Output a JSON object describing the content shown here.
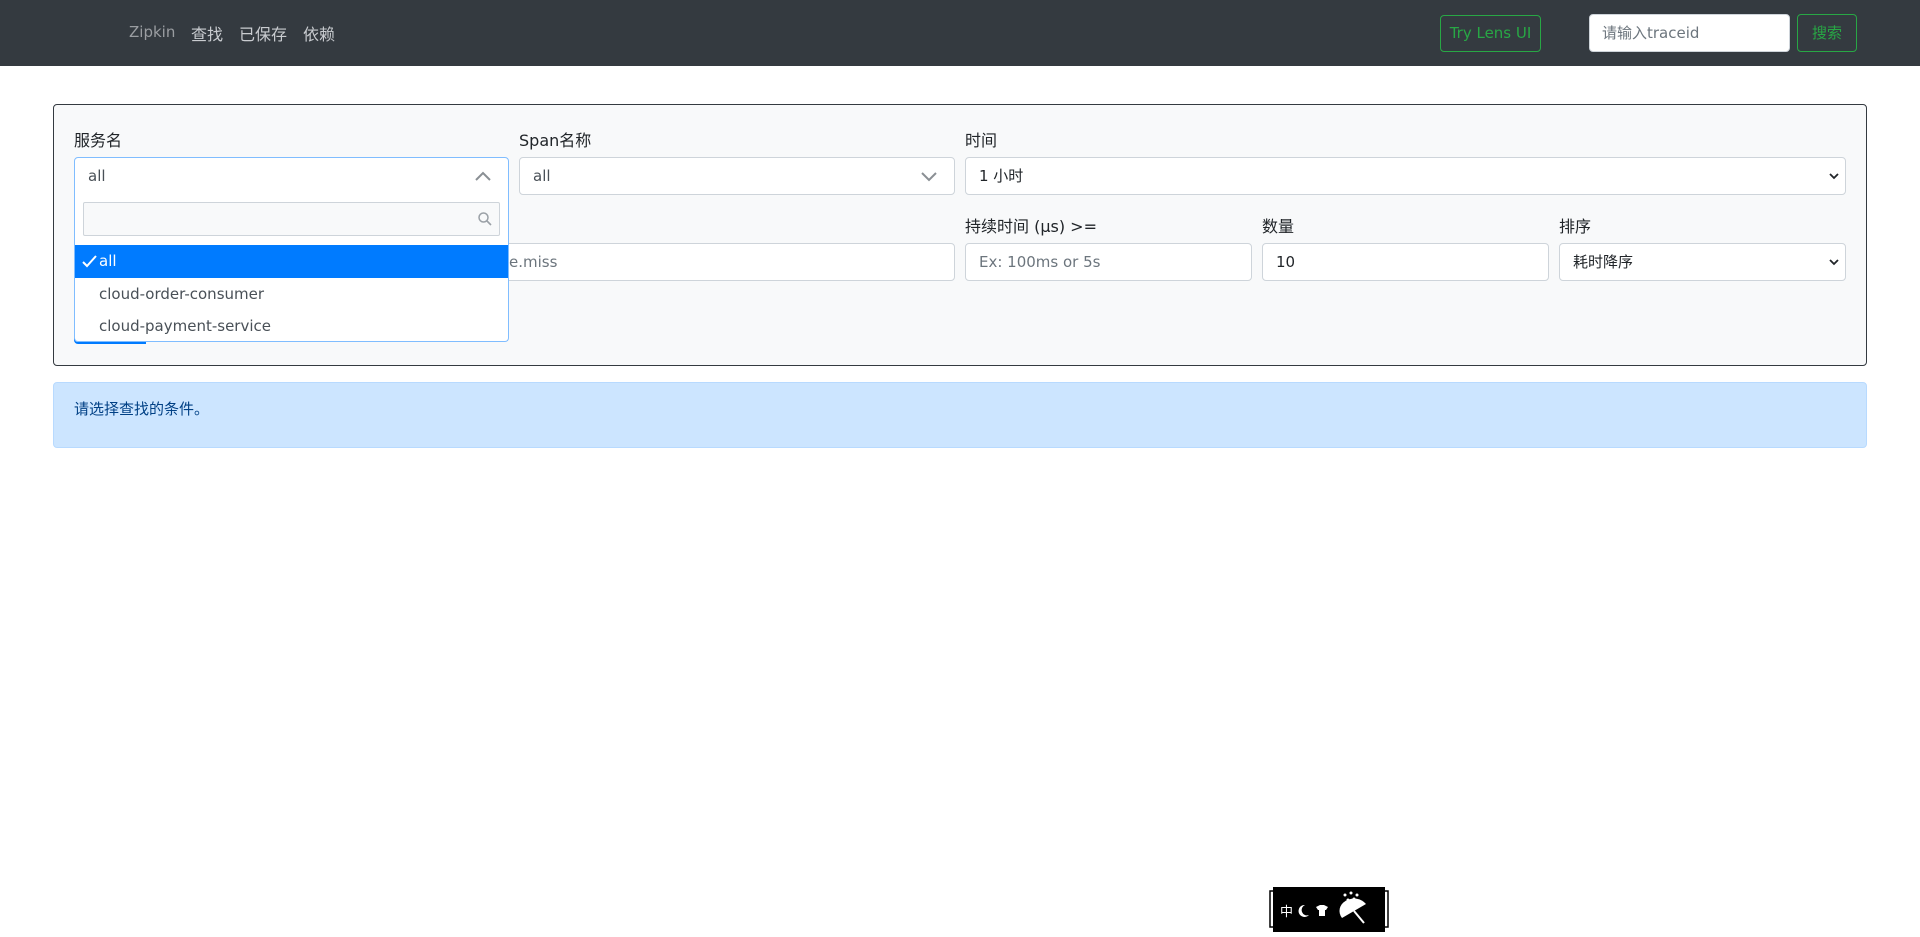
{
  "navbar": {
    "brand": "Zipkin",
    "links": [
      "查找",
      "已保存",
      "依赖"
    ],
    "lens_button": "Try Lens UI",
    "traceid_placeholder": "请输入traceid",
    "search_button": "搜索"
  },
  "search_form": {
    "service": {
      "label": "服务名",
      "value": "all",
      "dropdown_search_value": "",
      "options": [
        {
          "label": "all",
          "selected": true
        },
        {
          "label": "cloud-order-consumer",
          "selected": false
        },
        {
          "label": "cloud-payment-service",
          "selected": false
        }
      ]
    },
    "span": {
      "label": "Span名称",
      "value": "all"
    },
    "time": {
      "label": "时间",
      "value": "1 小时"
    },
    "annotations": {
      "visible_placeholder_fragment": "e.miss"
    },
    "duration": {
      "label": "持续时间 (μs) >=",
      "placeholder": "Ex: 100ms or 5s"
    },
    "limit": {
      "label": "数量",
      "value": "10"
    },
    "sort": {
      "label": "排序",
      "value": "耗时降序"
    }
  },
  "alert": {
    "message": "请选择查找的条件。"
  },
  "widget": {
    "text": "中",
    "icons": [
      "moon-icon",
      "shirt-icon",
      "umbrella-icon"
    ]
  },
  "colors": {
    "navbar_bg": "#343a40",
    "success": "#28a745",
    "primary": "#007bff",
    "alert_bg": "#cce5ff",
    "alert_text": "#004085"
  }
}
